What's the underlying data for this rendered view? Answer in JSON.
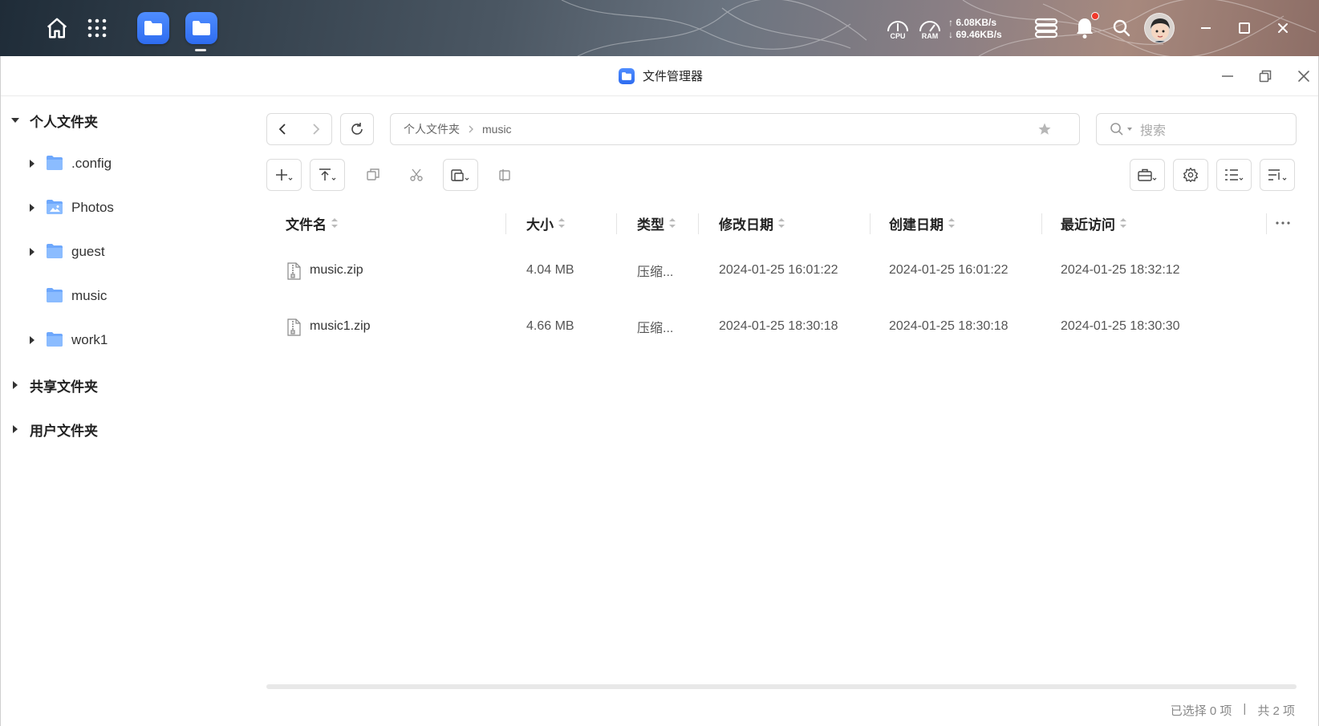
{
  "taskbar": {
    "cpu_label": "CPU",
    "ram_label": "RAM",
    "upload_speed": "↑ 6.08KB/s",
    "download_speed": "↓ 69.46KB/s",
    "has_notification": true
  },
  "window": {
    "title": "文件管理器"
  },
  "sidebar": {
    "personal": {
      "label": "个人文件夹",
      "expanded": true,
      "items": [
        {
          "label": ".config",
          "icon": "folder-icon",
          "has_children": true
        },
        {
          "label": "Photos",
          "icon": "photos-folder-icon",
          "has_children": true
        },
        {
          "label": "guest",
          "icon": "folder-icon",
          "has_children": true
        },
        {
          "label": "music",
          "icon": "folder-icon",
          "has_children": false
        },
        {
          "label": "work1",
          "icon": "folder-icon",
          "has_children": true
        }
      ]
    },
    "shared": {
      "label": "共享文件夹",
      "expanded": false
    },
    "users": {
      "label": "用户文件夹",
      "expanded": false
    }
  },
  "path": {
    "root": "个人文件夹",
    "current": "music"
  },
  "search": {
    "placeholder": "搜索"
  },
  "table": {
    "columns": [
      "文件名",
      "大小",
      "类型",
      "修改日期",
      "创建日期",
      "最近访问"
    ],
    "rows": [
      {
        "name": "music.zip",
        "size": "4.04 MB",
        "type": "压缩...",
        "modified": "2024-01-25 16:01:22",
        "created": "2024-01-25 16:01:22",
        "accessed": "2024-01-25 18:32:12"
      },
      {
        "name": "music1.zip",
        "size": "4.66 MB",
        "type": "压缩...",
        "modified": "2024-01-25 18:30:18",
        "created": "2024-01-25 18:30:18",
        "accessed": "2024-01-25 18:30:30"
      }
    ]
  },
  "status": {
    "selected": "已选择 0 项",
    "separator": "|",
    "total": "共 2 项"
  },
  "colors": {
    "accent": "#3276f2",
    "folder": "#6ea8fc",
    "notification": "#f0392b"
  }
}
